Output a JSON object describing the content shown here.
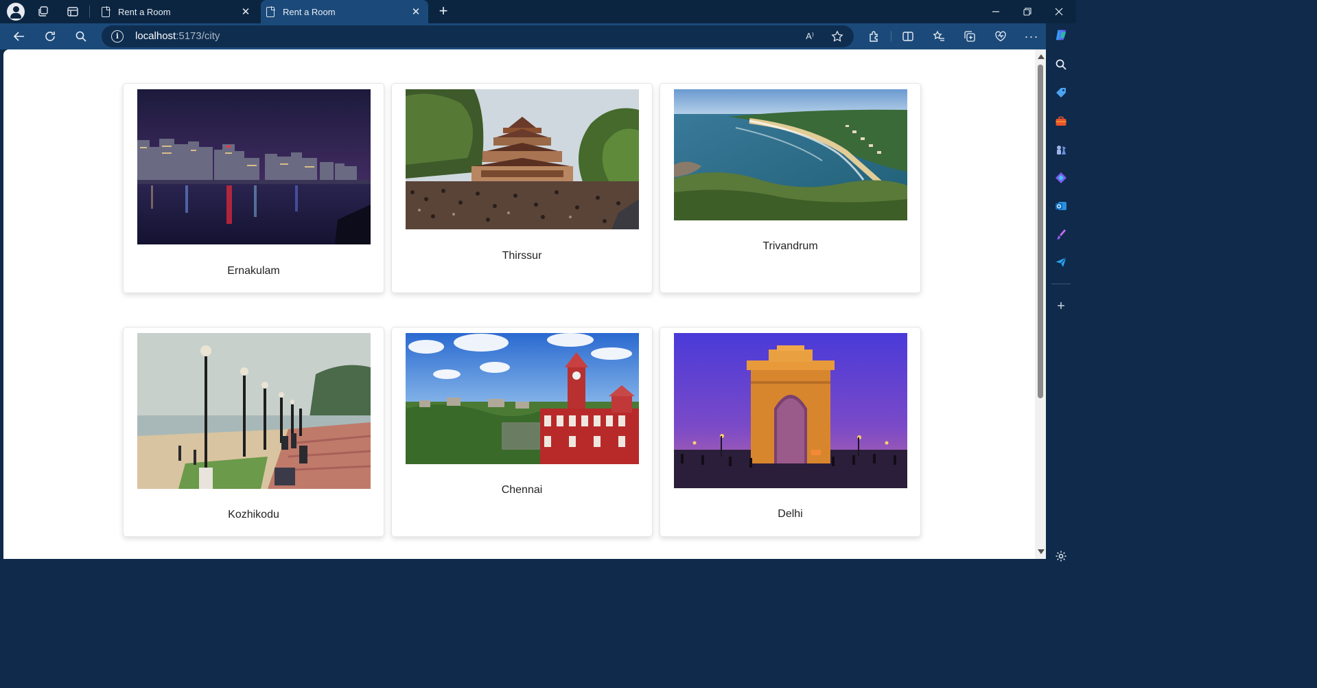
{
  "browser": {
    "tabs": [
      {
        "label": "Rent a Room",
        "active": false
      },
      {
        "label": "Rent a Room",
        "active": true
      }
    ],
    "url_host": "localhost",
    "url_path": ":5173/city",
    "read_aloud_label": "A⁾"
  },
  "cities": [
    {
      "name": "Ernakulam",
      "image": "night-city-waterfront-icon"
    },
    {
      "name": "Thirssur",
      "image": "temple-festival-crowd-icon"
    },
    {
      "name": "Trivandrum",
      "image": "coastal-beach-bay-icon"
    },
    {
      "name": "Kozhikodu",
      "image": "beach-promenade-lamps-icon"
    },
    {
      "name": "Chennai",
      "image": "red-heritage-building-icon"
    },
    {
      "name": "Delhi",
      "image": "india-gate-dusk-icon"
    }
  ],
  "colors": {
    "titlebar": "#0b2541",
    "toolbar": "#1b4a7a",
    "page_background": "#ffffff"
  }
}
